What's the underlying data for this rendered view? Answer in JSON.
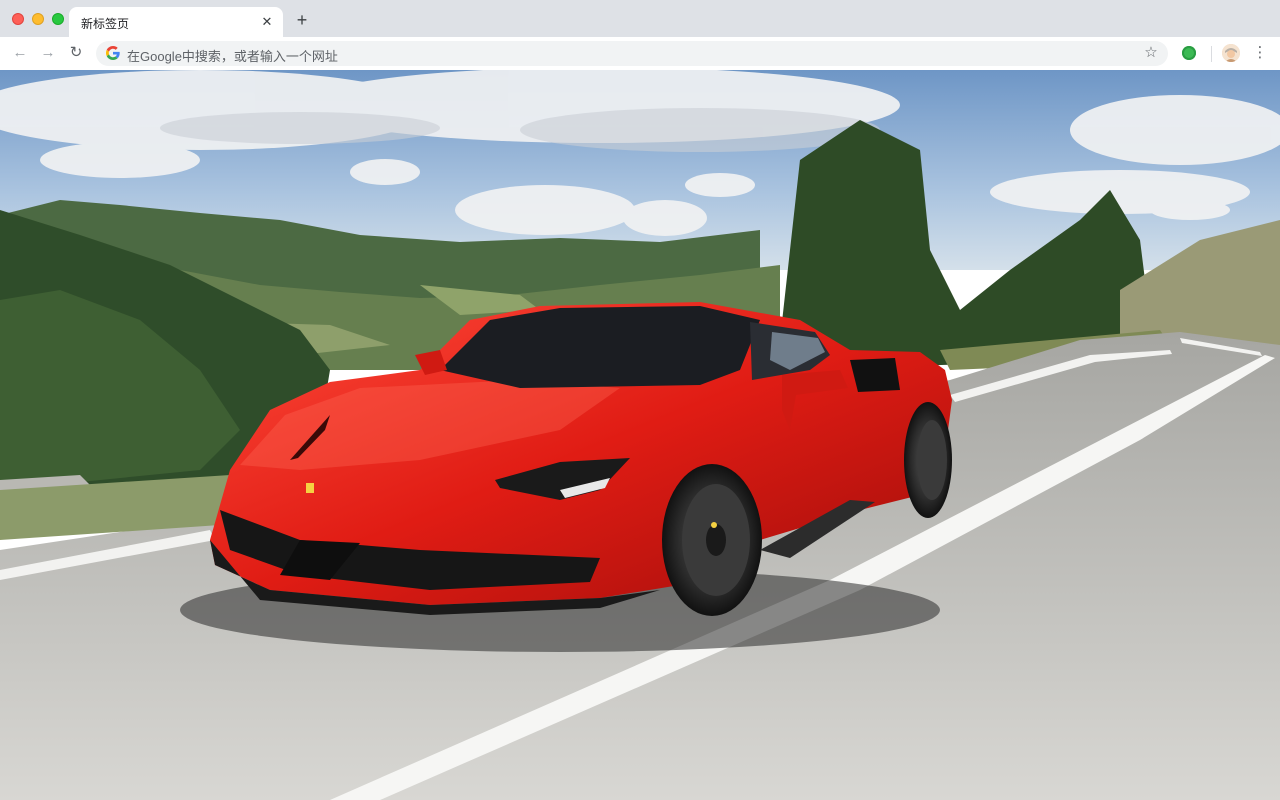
{
  "browser": {
    "tab": {
      "title": "新标签页",
      "close_glyph": "✕"
    },
    "new_tab_glyph": "+",
    "nav": {
      "back_glyph": "←",
      "forward_glyph": "→",
      "reload_glyph": "↻"
    },
    "omnibox": {
      "placeholder": "在Google中搜索，或者输入一个网址",
      "icon": "google-icon"
    },
    "bookmark_glyph": "☆",
    "menu_glyph": "⋮",
    "extension_color": "#3cba54"
  },
  "page": {
    "background_image": "red Ferrari sports car driving on a winding mountain road under a cloudy blue sky",
    "icon": "wallpaper-photo"
  }
}
